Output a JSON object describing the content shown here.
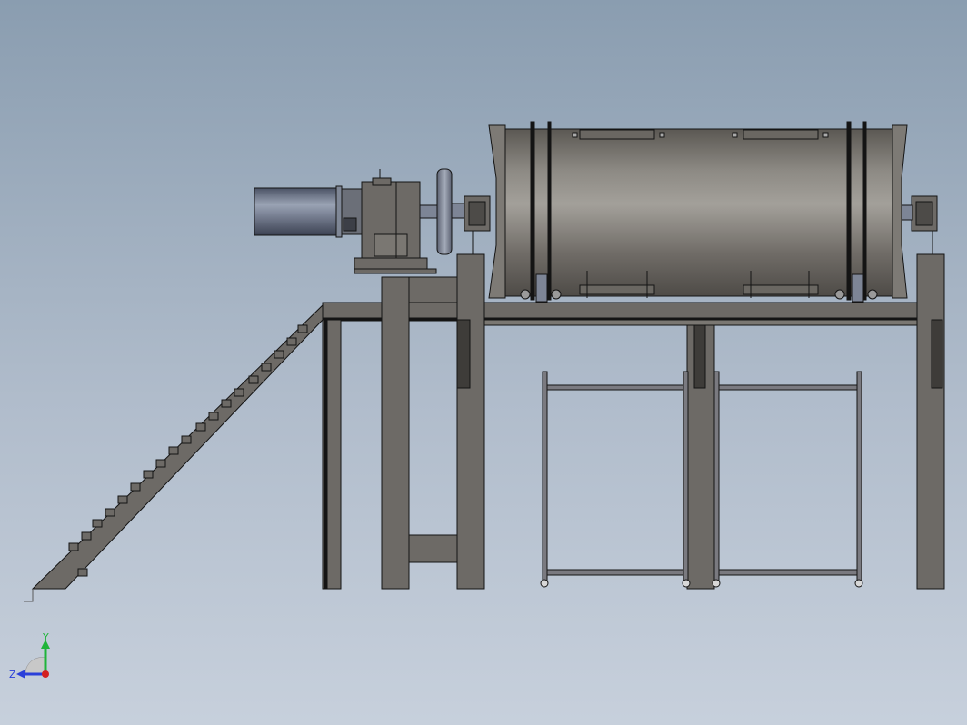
{
  "view": {
    "background_top": "#8a9db0",
    "background_bottom": "#c7d0dc",
    "steel_color": "#6d6a66",
    "edge_color": "#141414"
  },
  "triad": {
    "y_label": "Y",
    "z_label": "Z",
    "y_color": "#1fb43a",
    "z_color": "#2a3fd9",
    "x_color": "#d42020"
  }
}
